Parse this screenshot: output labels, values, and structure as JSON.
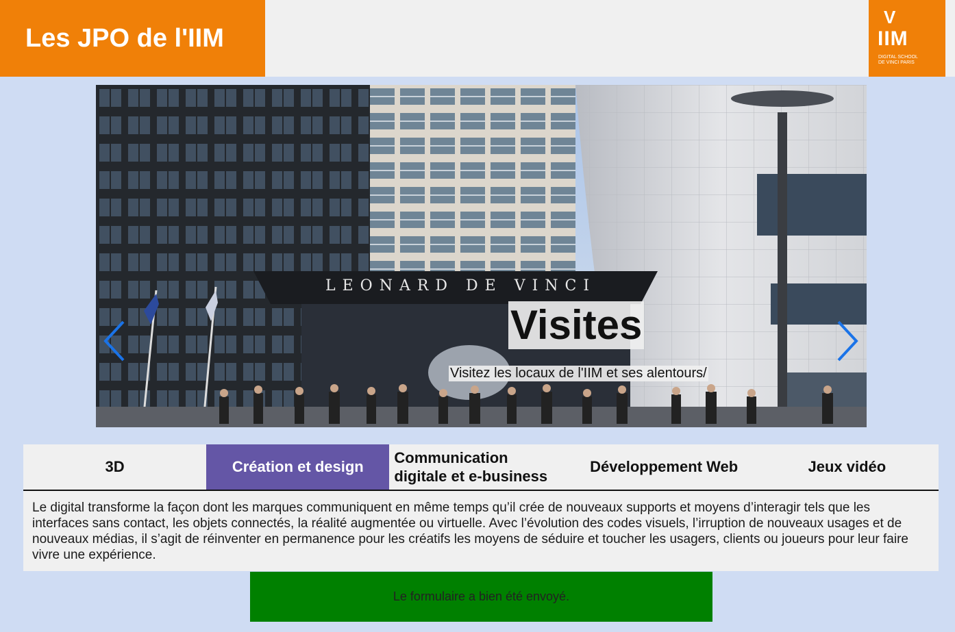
{
  "header": {
    "title": "Les JPO de l'IIM",
    "logo": {
      "mark": "V",
      "name": "IIM",
      "tagline_1": "DIGITAL SCHOOL",
      "tagline_2": "DE VINCI  PARIS"
    }
  },
  "carousel": {
    "title": "Visites",
    "subtitle": "Visitez les locaux de l'IIM et ses alentours/",
    "prev_icon": "chevron-left-icon",
    "next_icon": "chevron-right-icon",
    "arrow_color": "#1a73e8"
  },
  "tabs": [
    {
      "label": "3D",
      "active": false
    },
    {
      "label": "Création et design",
      "active": true
    },
    {
      "label": "Communication digitale et e-business",
      "line1": "Communication",
      "line2": "digitale et e-business",
      "active": false
    },
    {
      "label": "Développement Web",
      "active": false
    },
    {
      "label": "Jeux vidéo",
      "active": false
    }
  ],
  "description": "Le digital transforme la façon dont les marques communiquent en même temps qu’il crée de nouveaux supports et moyens d’interagir tels que les interfaces sans contact, les objets connectés, la réalité augmentée ou virtuelle. Avec l’évolution des codes visuels, l’irruption de nouveaux usages et de nouveaux médias, il s’agit de réinventer en permanence pour les créatifs les moyens de séduire et toucher les usagers, clients ou joueurs pour leur faire vivre une expérience.",
  "notice": "Le formulaire a bien été envoyé.",
  "colors": {
    "brand_orange": "#f08008",
    "active_tab": "#6456a6",
    "success": "#008000",
    "page_bg": "#cfdcf3"
  }
}
